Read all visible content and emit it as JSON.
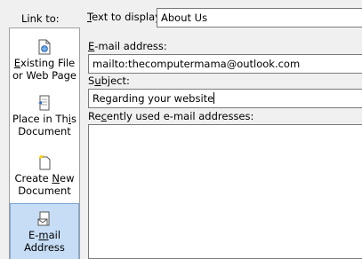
{
  "link_to": {
    "label": "Link to:",
    "items": [
      {
        "line1_pre": "",
        "line1_ul": "E",
        "line1_post": "xisting File",
        "line2": "or Web Page",
        "icon": "existing-file-icon"
      },
      {
        "line1_pre": "Place in Th",
        "line1_ul": "i",
        "line1_post": "s",
        "line2": "Document",
        "icon": "place-in-document-icon"
      },
      {
        "line1_pre": "Create ",
        "line1_ul": "N",
        "line1_post": "ew",
        "line2": "Document",
        "icon": "create-new-document-icon"
      },
      {
        "line1_pre": "E-",
        "line1_ul": "m",
        "line1_post": "ail",
        "line2": "Address",
        "icon": "email-address-icon",
        "selected": true
      }
    ]
  },
  "text_to_display": {
    "label_ul": "T",
    "label_rest": "ext to display:",
    "value": "About Us"
  },
  "email_address": {
    "label_ul": "E",
    "label_rest": "-mail address:",
    "value": "mailto:thecomputermama@outlook.com"
  },
  "subject": {
    "label_pre": "S",
    "label_ul": "u",
    "label_rest": "bject:",
    "value": "Regarding your website"
  },
  "recent": {
    "label_pre": "Re",
    "label_ul": "c",
    "label_rest": "ently used e-mail addresses:",
    "items": []
  }
}
